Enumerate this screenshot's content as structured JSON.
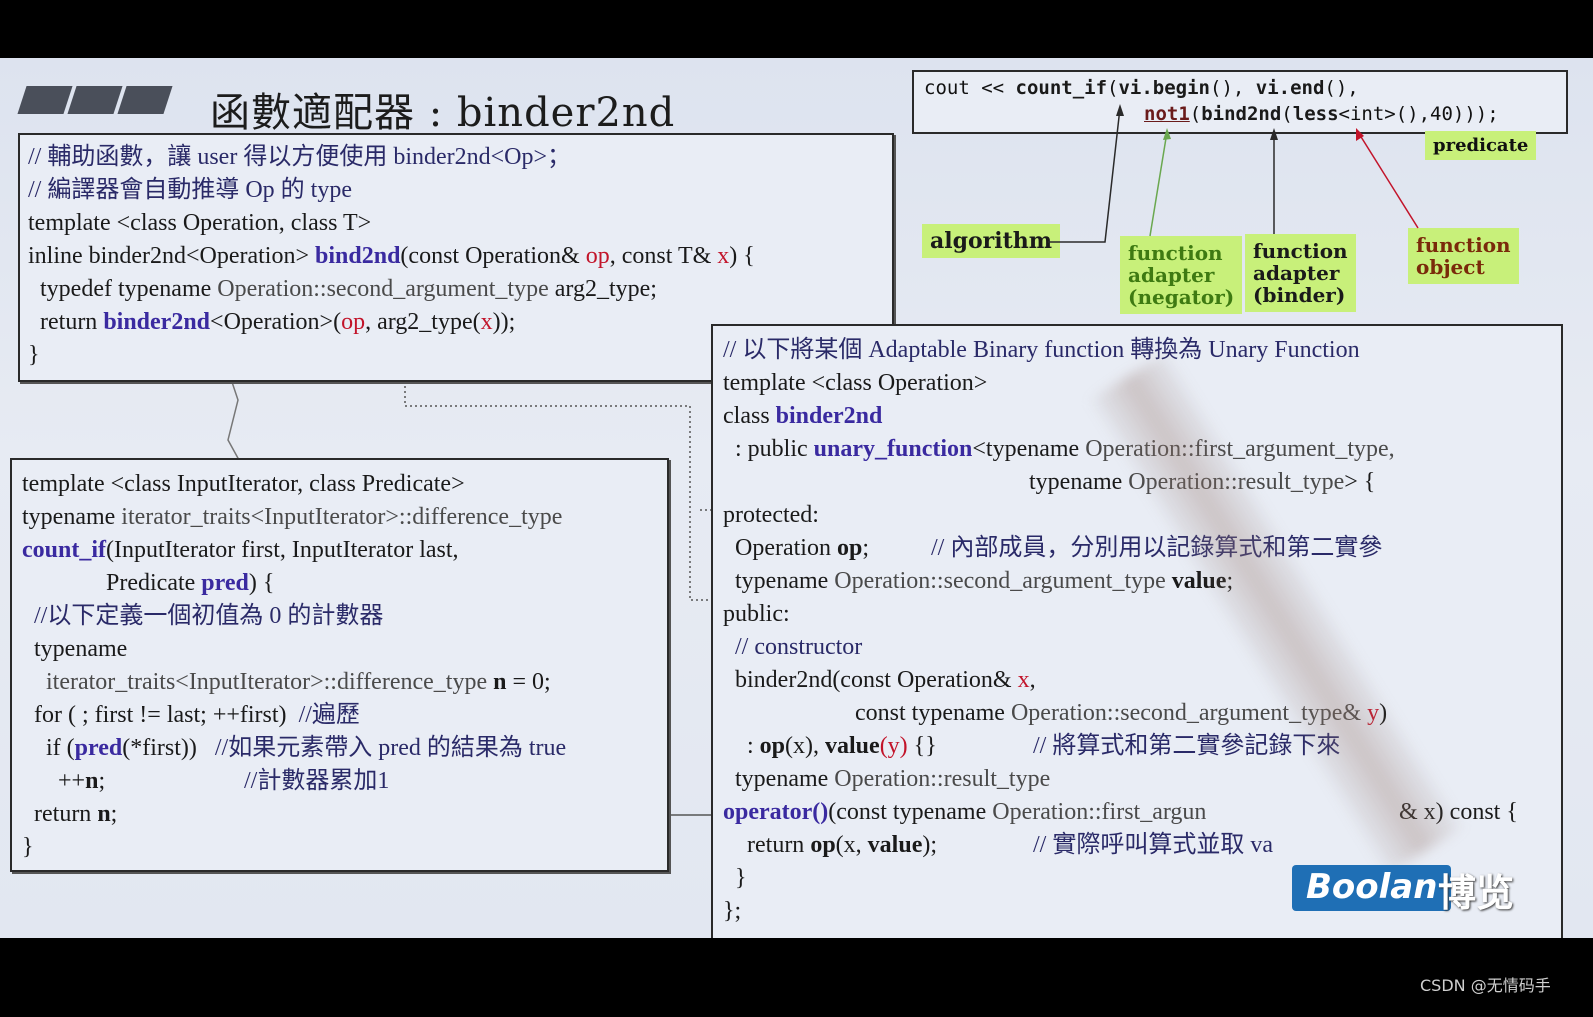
{
  "slide": {
    "title": "函數適配器 : binder2nd"
  },
  "top_code": {
    "line1_a": "cout << ",
    "line1_b": "count_if",
    "line1_c": "(",
    "line1_d": "vi.begin",
    "line1_e": "(), ",
    "line1_f": "vi.end",
    "line1_g": "(),",
    "line2_a": "not1",
    "line2_b": "(",
    "line2_c": "bind2nd",
    "line2_d": "(",
    "line2_e": "less",
    "line2_f": "<int>(),40)));"
  },
  "labels": {
    "predicate": "predicate",
    "algorithm": "algorithm",
    "negator_1": "function",
    "negator_2": "adapter",
    "negator_3": "(negator)",
    "binder_1": "function",
    "binder_2": "adapter",
    "binder_3": "(binder)",
    "fobj_1": "function",
    "fobj_2": "object"
  },
  "box_a": {
    "l1": "// 輔助函數，讓 user 得以方便使用 binder2nd<Op>；",
    "l2": "// 編譯器會自動推導 Op 的 type",
    "l3": "template <class Operation, class T>",
    "l4_a": "inline binder2nd<Operation> ",
    "l4_b": "bind2nd",
    "l4_c": "(const Operation& ",
    "l4_d": "op",
    "l4_e": ", const T& ",
    "l4_f": "x",
    "l4_g": ") {",
    "l5_a": "  typedef typename ",
    "l5_b": "Operation::second_argument_type",
    "l5_c": " arg2_type;",
    "l6_a": "  return ",
    "l6_b": "binder2nd",
    "l6_c": "<Operation>(",
    "l6_d": "op",
    "l6_e": ", arg2_type(",
    "l6_f": "x",
    "l6_g": "));",
    "l7": "}"
  },
  "box_b": {
    "l1": "template <class InputIterator, class Predicate>",
    "l2_a": "typename ",
    "l2_b": "iterator_traits<InputIterator>::difference_type",
    "l3_a": "count_if",
    "l3_b": "(InputIterator first, InputIterator last,",
    "l4_a": "              Predicate ",
    "l4_b": "pred",
    "l4_c": ") {",
    "l5": "  //以下定義一個初值為 0 的計數器",
    "l6": "  typename",
    "l7_a": "    iterator_traits<InputIterator>::difference_type ",
    "l7_b": "n",
    "l7_c": " = 0;",
    "l8_a": "  for ( ; first != last; ++first)  ",
    "l8_b": "//遍歷",
    "l9_a": "    if (",
    "l9_b": "pred",
    "l9_c": "(*first))   ",
    "l9_d": "//如果元素帶入 pred 的結果為 true",
    "l10_a": "      ++",
    "l10_b": "n",
    "l10_c": ";",
    "l10_d": "//計數器累加1",
    "l11_a": "  return ",
    "l11_b": "n",
    "l11_c": ";",
    "l12": "}"
  },
  "box_c": {
    "l1": "// 以下將某個 Adaptable Binary function 轉換為 Unary Function",
    "l2": "template <class Operation>",
    "l3_a": "class ",
    "l3_b": "binder2nd",
    "l4_a": "  : public ",
    "l4_b": "unary_function",
    "l4_c": "<typename ",
    "l4_d": "Operation::first_argument_type,",
    "l5_a": "typename ",
    "l5_b": "Operation::result_type",
    "l5_c": "> {",
    "l6": "protected:",
    "l7_a": "  Operation ",
    "l7_b": "op",
    "l7_c": ";",
    "l7_d": "// 內部成員，分別用以記錄算式和第二實參",
    "l8_a": "  typename ",
    "l8_b": "Operation::second_argument_type ",
    "l8_c": "value",
    "l8_d": ";",
    "l9": "public:",
    "l10": "  // constructor",
    "l11_a": "  binder2nd(const Operation& ",
    "l11_b": "x",
    "l11_c": ",",
    "l12_a": "const typename ",
    "l12_b": "Operation::second_argument_type& ",
    "l12_c": "y",
    "l12_d": ")",
    "l13_a": "    : ",
    "l13_b": "op",
    "l13_c": "(x), ",
    "l13_d": "value",
    "l13_e": "(y)",
    "l13_f": " {}",
    "l13_g": "// 將算式和第二實參記錄下來",
    "l14_a": "  typename ",
    "l14_b": "Operation::result_type",
    "l15_a": "operator()",
    "l15_b": "(const typename ",
    "l15_c": "Operation::first_argun",
    "l15_d": "& x) const {",
    "l16_a": "    return ",
    "l16_b": "op",
    "l16_c": "(x, ",
    "l16_d": "value",
    "l16_e": ");",
    "l16_f": "// 實際呼叫算式並取 va",
    "l17": "  }",
    "l18": "};"
  },
  "branding": {
    "logo_en": "Boolan",
    "logo_cn": "博览",
    "watermark": "CSDN @无情码手"
  },
  "colors": {
    "label_bg": "#c8f07a",
    "keyword": "#3a2aa0",
    "param_red": "#c2142a",
    "brand_blue": "#1f6fb5"
  }
}
